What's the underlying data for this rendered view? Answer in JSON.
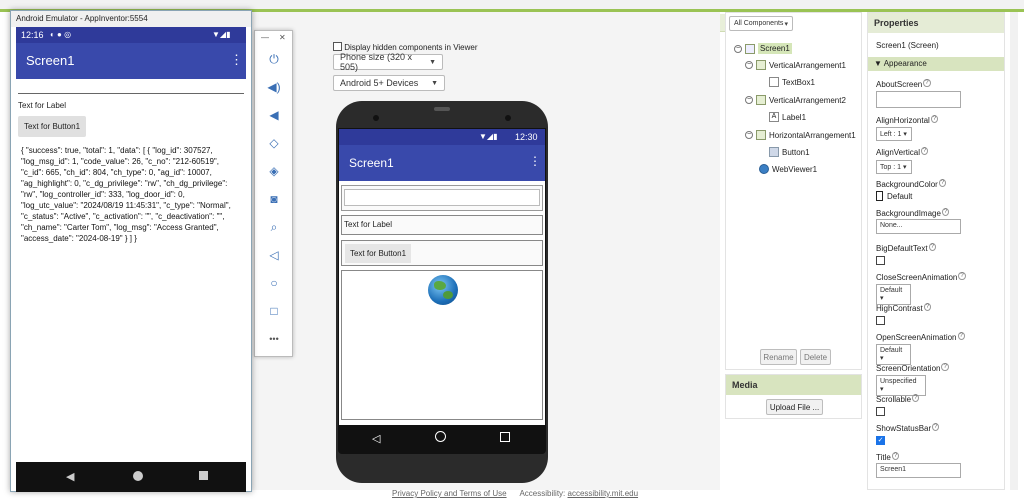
{
  "emulator": {
    "title": "Android Emulator - AppInventor:5554",
    "minimize": "—",
    "close": "✕",
    "status_time": "12:16",
    "screen_title": "Screen1",
    "label_text": "Text for Label",
    "button_text": "Text for Button1",
    "json_output": "{ \"success\": true, \"total\": 1, \"data\": [ { \"log_id\": 307527, \"log_msg_id\": 1, \"code_value\": 26, \"c_no\": \"212-60519\", \"c_id\": 665, \"ch_id\": 804, \"ch_type\": 0, \"ag_id\": 10007, \"ag_highlight\": 0, \"c_dg_privilege\": \"rw\", \"ch_dg_privilege\": \"rw\", \"log_controller_id\": 333, \"log_door_id\": 0, \"log_utc_value\": \"2024/08/19 11:45:31\", \"c_type\": \"Normal\", \"c_status\": \"Active\", \"c_activation\": \"\", \"c_deactivation\": \"\", \"ch_name\": \"Carter Tom\", \"log_msg\": \"Access Granted\", \"access_date\": \"2024-08-19\" } ] }"
  },
  "emulator_tools": {
    "minimize": "—",
    "close": "✕",
    "more": "•••"
  },
  "viewer": {
    "hidden_components_label": "Display hidden components in Viewer",
    "phone_size": "Phone size (320 x 505)",
    "android_version": "Android 5+ Devices",
    "status_time": "12:30",
    "screen_title": "Screen1",
    "label_text": "Text for Label",
    "button_text": "Text for Button1"
  },
  "components": {
    "dropdown": "All Components",
    "tree": [
      {
        "label": "Screen1",
        "level": 0
      },
      {
        "label": "VerticalArrangement1",
        "level": 1
      },
      {
        "label": "TextBox1",
        "level": 2
      },
      {
        "label": "VerticalArrangement2",
        "level": 1
      },
      {
        "label": "Label1",
        "level": 2
      },
      {
        "label": "HorizontalArrangement1",
        "level": 1
      },
      {
        "label": "Button1",
        "level": 2
      },
      {
        "label": "WebViewer1",
        "level": 1
      }
    ],
    "rename": "Rename",
    "delete": "Delete"
  },
  "media": {
    "header": "Media",
    "upload": "Upload File ..."
  },
  "properties": {
    "header": "Properties",
    "subject": "Screen1 (Screen)",
    "section": "Appearance",
    "about_screen": "AboutScreen",
    "align_horizontal": "AlignHorizontal",
    "align_horizontal_value": "Left : 1",
    "align_vertical": "AlignVertical",
    "align_vertical_value": "Top : 1",
    "background_color": "BackgroundColor",
    "background_color_value": "Default",
    "background_image": "BackgroundImage",
    "background_image_value": "None...",
    "big_default_text": "BigDefaultText",
    "close_screen_animation": "CloseScreenAnimation",
    "close_screen_animation_value": "Default",
    "high_contrast": "HighContrast",
    "open_screen_animation": "OpenScreenAnimation",
    "open_screen_animation_value": "Default",
    "screen_orientation": "ScreenOrientation",
    "screen_orientation_value": "Unspecified",
    "scrollable": "Scrollable",
    "show_status_bar": "ShowStatusBar",
    "title": "Title",
    "title_value": "Screen1",
    "help_mark": "?"
  },
  "footer": {
    "privacy": "Privacy Policy and Terms of Use",
    "accessibility_label": "Accessibility:",
    "accessibility_link": "accessibility.mit.edu"
  },
  "colors": {
    "accent_green": "#9ac354",
    "app_bar": "#3949ab"
  }
}
